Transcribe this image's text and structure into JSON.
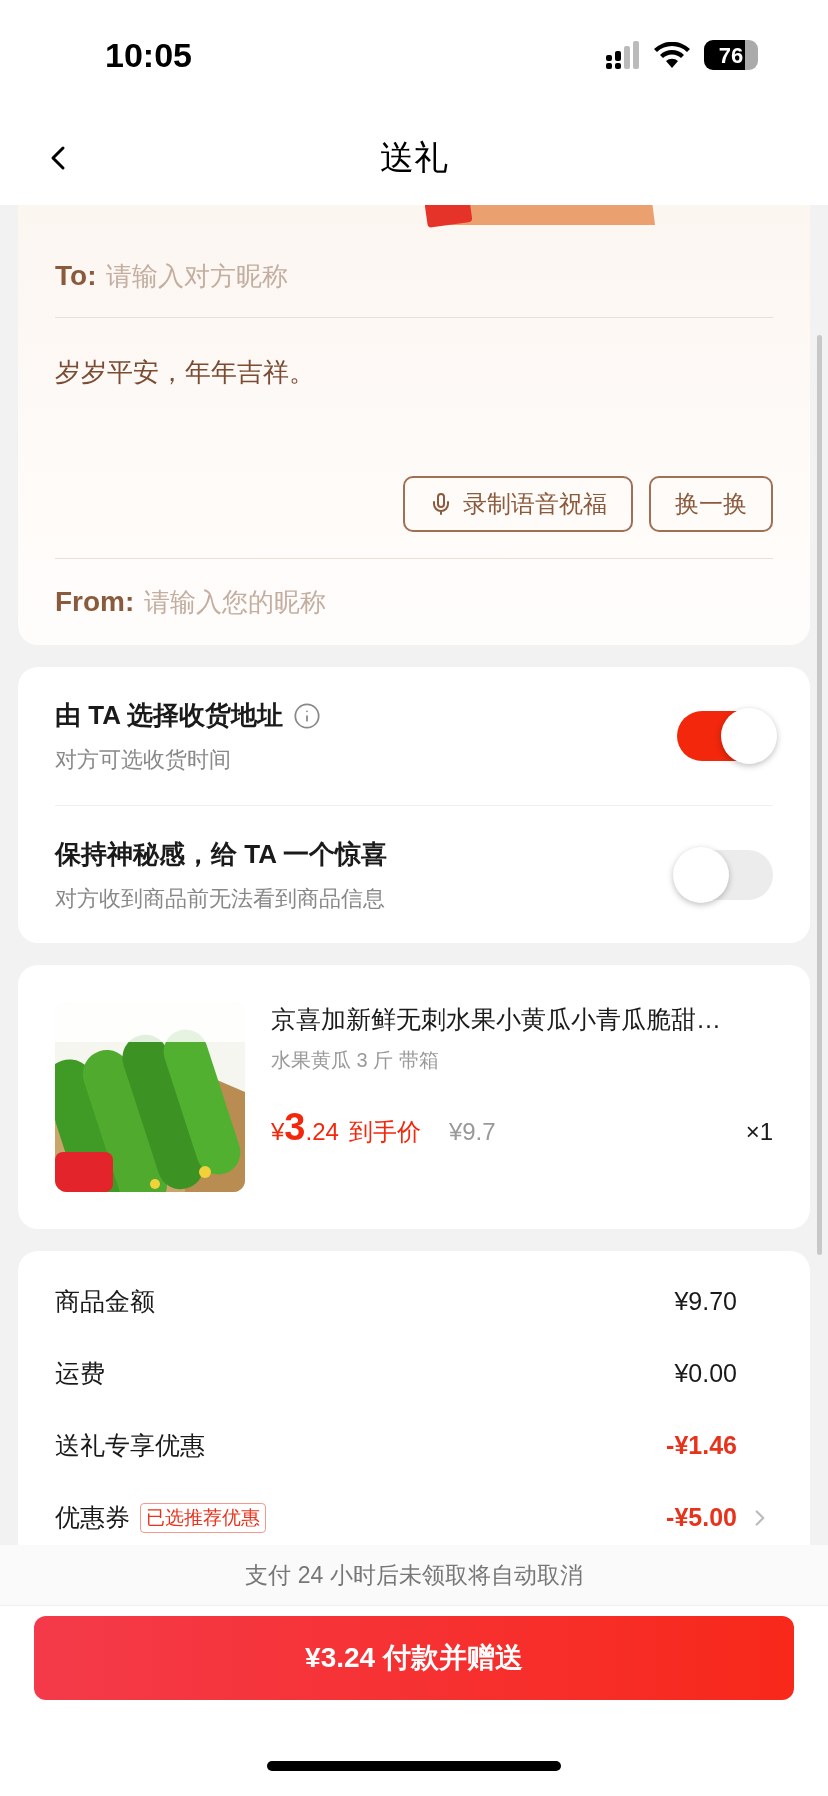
{
  "status_bar": {
    "time": "10:05",
    "battery": "76"
  },
  "nav": {
    "title": "送礼"
  },
  "greeting": {
    "to_label": "To:",
    "to_placeholder": "请输入对方昵称",
    "message": "岁岁平安，年年吉祥。",
    "buttons": [
      {
        "label": "录制语音祝福",
        "kind": "voice"
      },
      {
        "label": "换一换",
        "kind": "plain"
      }
    ],
    "from_label": "From:",
    "from_placeholder": "请输入您的昵称"
  },
  "options": [
    {
      "title": "由 TA 选择收货地址",
      "subtitle": "对方可选收货时间",
      "info": true,
      "on": true
    },
    {
      "title": "保持神秘感，给 TA 一个惊喜",
      "subtitle": "对方收到商品前无法看到商品信息",
      "info": false,
      "on": false
    }
  ],
  "product": {
    "title": "京喜加新鲜无刺水果小黄瓜小青瓜脆甜…",
    "spec": "水果黄瓜 3 斤 带箱",
    "currency": "¥",
    "price_int": "3",
    "price_dec": ".24",
    "price_label": "到手价",
    "original_price": "¥9.7",
    "quantity": "×1"
  },
  "summary": [
    {
      "label": "商品金额",
      "value": "¥9.70",
      "kind": "plain",
      "chevron": false
    },
    {
      "label": "运费",
      "value": "¥0.00",
      "kind": "plain",
      "chevron": false
    },
    {
      "label": "送礼专享优惠",
      "value": "-¥1.46",
      "kind": "discount",
      "chevron": false
    },
    {
      "label": "优惠券",
      "tag": "已选推荐优惠",
      "value": "-¥5.00",
      "kind": "discount",
      "chevron": true
    }
  ],
  "notice": "支付 24 小时后未领取将自动取消",
  "pay_button": "¥3.24 付款并赠送"
}
